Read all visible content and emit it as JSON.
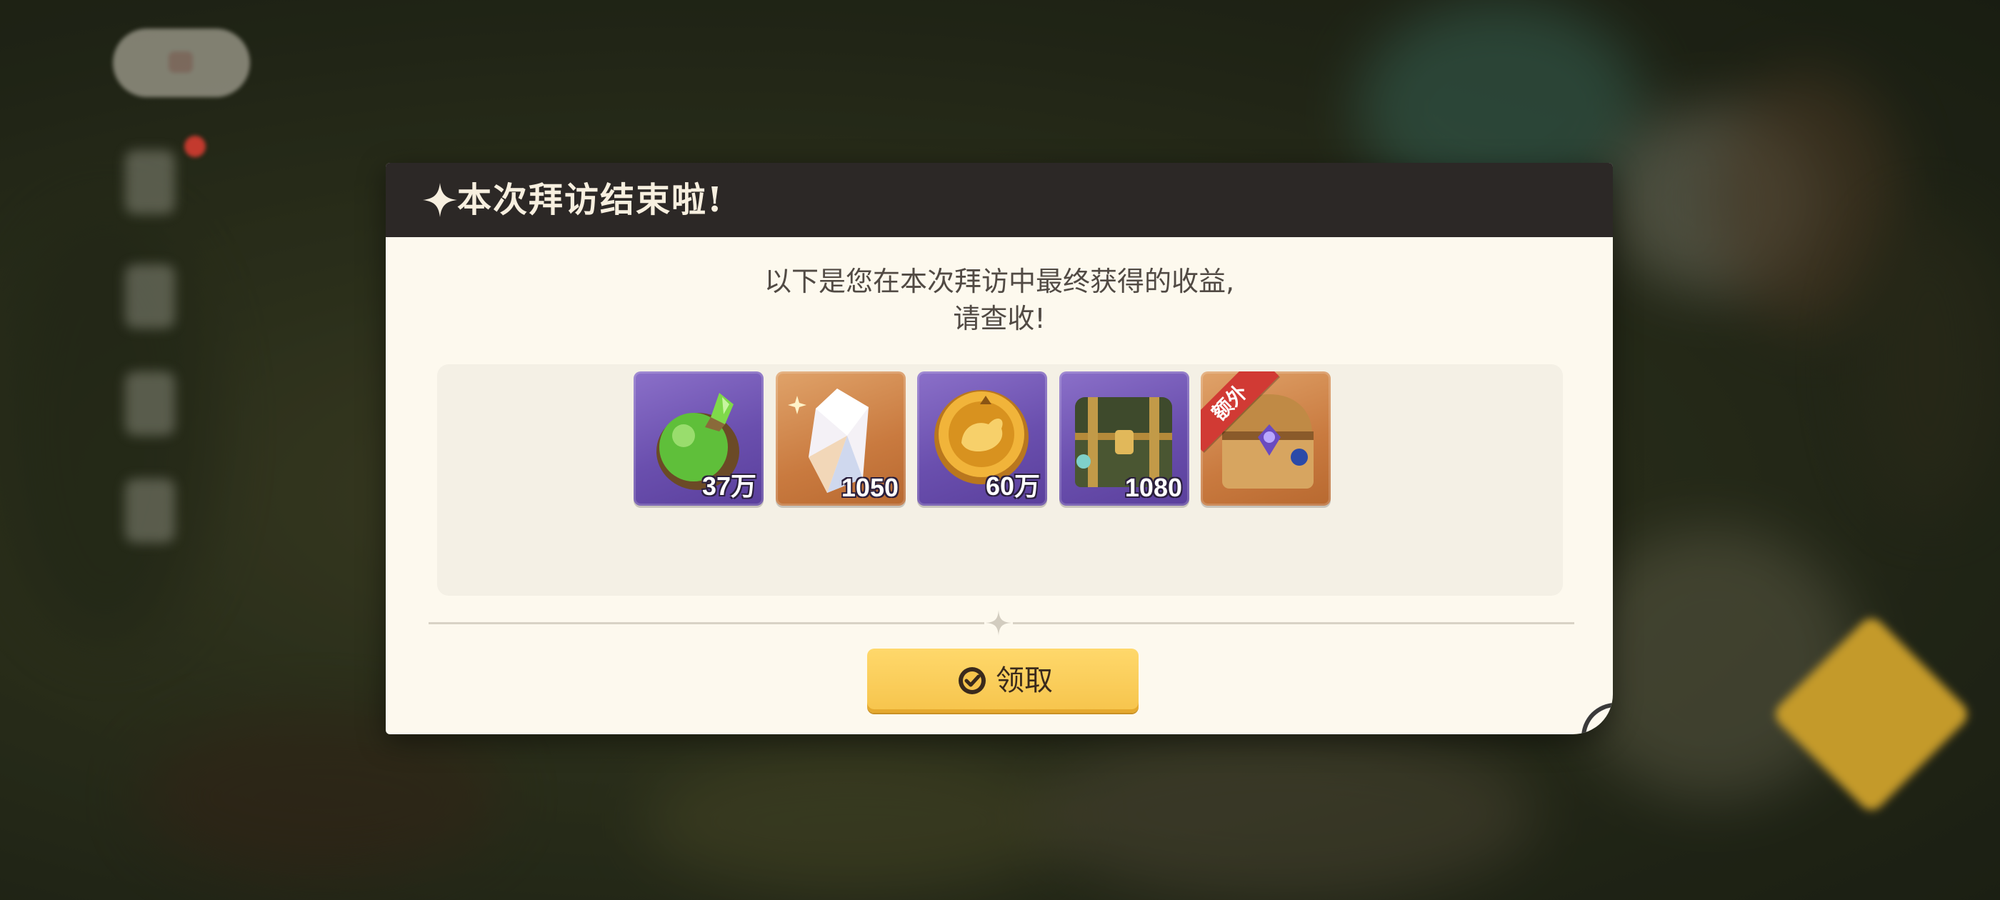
{
  "dialog": {
    "title": "本次拜访结束啦!",
    "message_line1": "以下是您在本次拜访中最终获得的收益,",
    "message_line2": "请查收!",
    "claim_label": "领取"
  },
  "rewards": [
    {
      "icon": "green-potion-icon",
      "count": "37万",
      "frame": "purple"
    },
    {
      "icon": "crystal-icon",
      "count": "1050",
      "frame": "orange"
    },
    {
      "icon": "gold-coin-icon",
      "count": "60万",
      "frame": "purple"
    },
    {
      "icon": "treasure-chest-icon",
      "count": "1080",
      "frame": "purple"
    },
    {
      "icon": "golden-chest-icon",
      "count": "",
      "frame": "orange",
      "ribbon": "额外"
    }
  ],
  "colors": {
    "title_bar": "#2c2826",
    "dialog_bg": "#fdf9ee",
    "button": "#f6c44c",
    "purple_frame": "#6a4fae",
    "orange_frame": "#c97a3f",
    "ribbon": "#d13a34"
  }
}
